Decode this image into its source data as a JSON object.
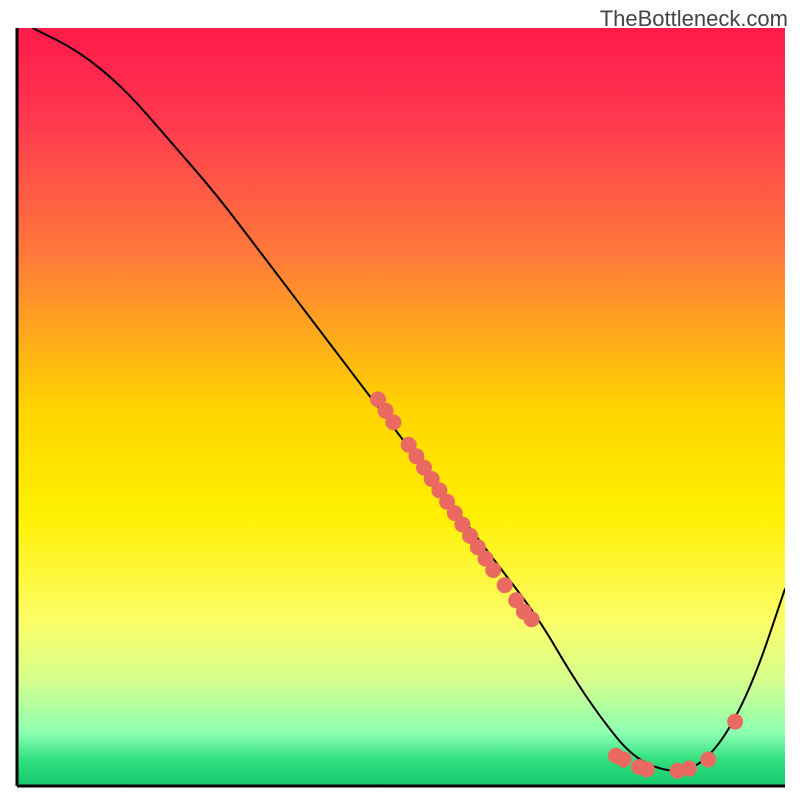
{
  "watermark": "TheBottleneck.com",
  "chart_data": {
    "type": "line",
    "title": "",
    "xlabel": "",
    "ylabel": "",
    "xlim": [
      0,
      100
    ],
    "ylim": [
      0,
      100
    ],
    "grid": false,
    "legend": false,
    "background_gradient": {
      "stops": [
        {
          "pos": 0.0,
          "color": "#ff1a4a"
        },
        {
          "pos": 0.12,
          "color": "#ff3850"
        },
        {
          "pos": 0.3,
          "color": "#ff7a3a"
        },
        {
          "pos": 0.5,
          "color": "#ffd400"
        },
        {
          "pos": 0.64,
          "color": "#fff000"
        },
        {
          "pos": 0.78,
          "color": "#fdfd66"
        },
        {
          "pos": 0.86,
          "color": "#d6ff8d"
        },
        {
          "pos": 0.93,
          "color": "#8cffb1"
        },
        {
          "pos": 0.965,
          "color": "#32e07f"
        },
        {
          "pos": 1.0,
          "color": "#13c96b"
        }
      ]
    },
    "series": [
      {
        "name": "bottleneck-curve",
        "x": [
          2,
          8,
          14,
          20,
          26,
          32,
          38,
          44,
          50,
          56,
          62,
          68,
          72,
          76,
          80,
          84,
          88,
          92,
          96,
          100
        ],
        "y": [
          100,
          97,
          92,
          85,
          78,
          70,
          62,
          54,
          46,
          38,
          30,
          22,
          15,
          9,
          4,
          2,
          2,
          6,
          14,
          26
        ]
      }
    ],
    "scatter_points": {
      "name": "marked-points",
      "points": [
        {
          "x": 47,
          "y": 51
        },
        {
          "x": 48,
          "y": 49.5
        },
        {
          "x": 49,
          "y": 48
        },
        {
          "x": 51,
          "y": 45
        },
        {
          "x": 52,
          "y": 43.5
        },
        {
          "x": 53,
          "y": 42
        },
        {
          "x": 54,
          "y": 40.5
        },
        {
          "x": 55,
          "y": 39
        },
        {
          "x": 56,
          "y": 37.5
        },
        {
          "x": 57,
          "y": 36
        },
        {
          "x": 58,
          "y": 34.5
        },
        {
          "x": 59,
          "y": 33
        },
        {
          "x": 60,
          "y": 31.5
        },
        {
          "x": 61,
          "y": 30
        },
        {
          "x": 62,
          "y": 28.5
        },
        {
          "x": 63.5,
          "y": 26.5
        },
        {
          "x": 65,
          "y": 24.5
        },
        {
          "x": 66,
          "y": 23
        },
        {
          "x": 67,
          "y": 22
        },
        {
          "x": 78,
          "y": 4
        },
        {
          "x": 79,
          "y": 3.5
        },
        {
          "x": 81,
          "y": 2.5
        },
        {
          "x": 82,
          "y": 2.2
        },
        {
          "x": 86,
          "y": 2
        },
        {
          "x": 87.5,
          "y": 2.3
        },
        {
          "x": 90,
          "y": 3.5
        },
        {
          "x": 93.5,
          "y": 8.5
        }
      ]
    }
  }
}
